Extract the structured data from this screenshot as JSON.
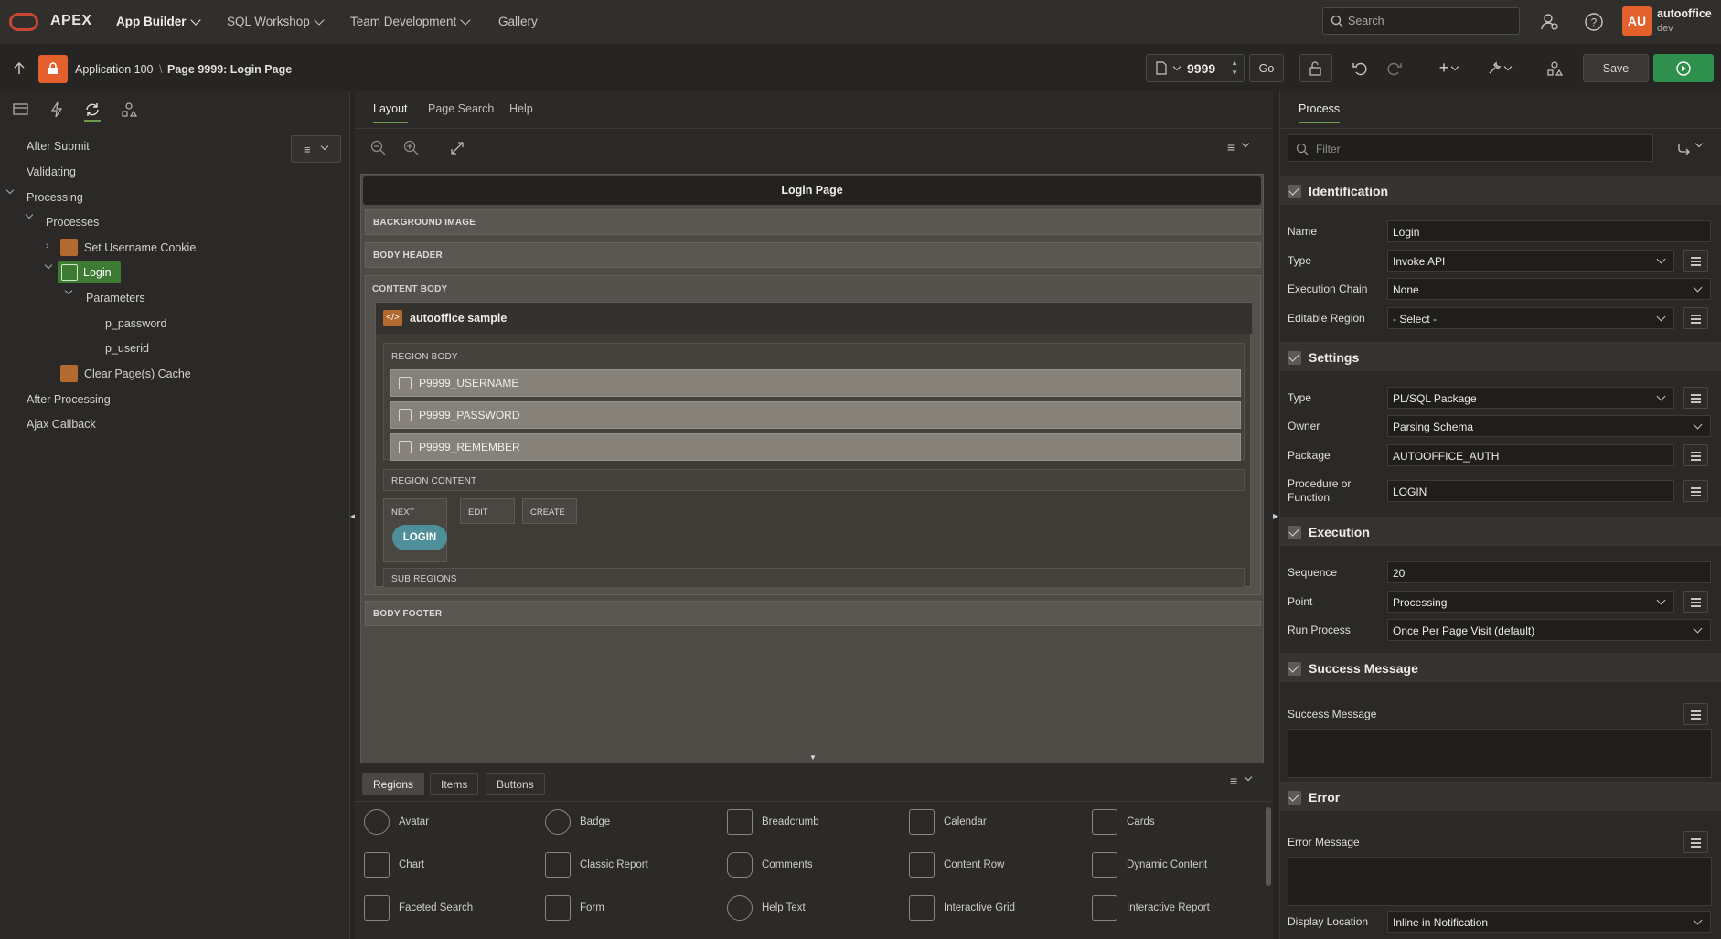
{
  "topnav": {
    "brand": "APEX",
    "items": [
      {
        "label": "App Builder",
        "active": true
      },
      {
        "label": "SQL Workshop"
      },
      {
        "label": "Team Development"
      },
      {
        "label": "Gallery"
      }
    ],
    "search_placeholder": "Search",
    "user": {
      "initials": "AU",
      "name": "autooffice",
      "sub": "dev"
    }
  },
  "toolbar": {
    "app_crumb": "Application 100",
    "page_crumb": "Page 9999: Login Page",
    "page_number": "9999",
    "go_label": "Go",
    "save_label": "Save"
  },
  "left": {
    "tree": {
      "after_submit": "After Submit",
      "validating": "Validating",
      "processing": "Processing",
      "processes": "Processes",
      "set_username_cookie": "Set Username Cookie",
      "login": "Login",
      "parameters": "Parameters",
      "p_password": "p_password",
      "p_userid": "p_userid",
      "clear_cache": "Clear Page(s) Cache",
      "after_processing": "After Processing",
      "ajax_callback": "Ajax Callback"
    }
  },
  "center": {
    "tabs": [
      "Layout",
      "Page Search",
      "Help"
    ],
    "page_title": "Login Page",
    "background_image": "BACKGROUND IMAGE",
    "body_header": "BODY HEADER",
    "content_body": "CONTENT BODY",
    "region_title": "autooffice sample",
    "region_body": "REGION BODY",
    "items": [
      "P9999_USERNAME",
      "P9999_PASSWORD",
      "P9999_REMEMBER"
    ],
    "region_content": "REGION CONTENT",
    "button_slots": [
      "NEXT",
      "EDIT",
      "CREATE"
    ],
    "login_button": "LOGIN",
    "sub_regions": "SUB REGIONS",
    "body_footer": "BODY FOOTER"
  },
  "gallery": {
    "tabs": [
      "Regions",
      "Items",
      "Buttons"
    ],
    "items": [
      "Avatar",
      "Badge",
      "Breadcrumb",
      "Calendar",
      "Cards",
      "Chart",
      "Classic Report",
      "Comments",
      "Content Row",
      "Dynamic Content",
      "Faceted Search",
      "Form",
      "Help Text",
      "Interactive Grid",
      "Interactive Report"
    ]
  },
  "right": {
    "tab": "Process",
    "filter_placeholder": "Filter",
    "identification": {
      "title": "Identification",
      "name_label": "Name",
      "name_value": "Login",
      "type_label": "Type",
      "type_value": "Invoke API",
      "chain_label": "Execution Chain",
      "chain_value": "None",
      "region_label": "Editable Region",
      "region_value": "- Select -"
    },
    "settings": {
      "title": "Settings",
      "type_label": "Type",
      "type_value": "PL/SQL Package",
      "owner_label": "Owner",
      "owner_value": "Parsing Schema",
      "package_label": "Package",
      "package_value": "AUTOOFFICE_AUTH",
      "proc_label": "Procedure or Function",
      "proc_value": "LOGIN"
    },
    "execution": {
      "title": "Execution",
      "seq_label": "Sequence",
      "seq_value": "20",
      "point_label": "Point",
      "point_value": "Processing",
      "run_label": "Run Process",
      "run_value": "Once Per Page Visit (default)"
    },
    "success": {
      "title": "Success Message",
      "label": "Success Message"
    },
    "error": {
      "title": "Error",
      "label": "Error Message",
      "display_label": "Display Location",
      "display_value": "Inline in Notification"
    }
  },
  "colors": {
    "accent_green": "#2f8f4c",
    "brand_red": "#c74634",
    "app_orange": "#e35f2c"
  }
}
